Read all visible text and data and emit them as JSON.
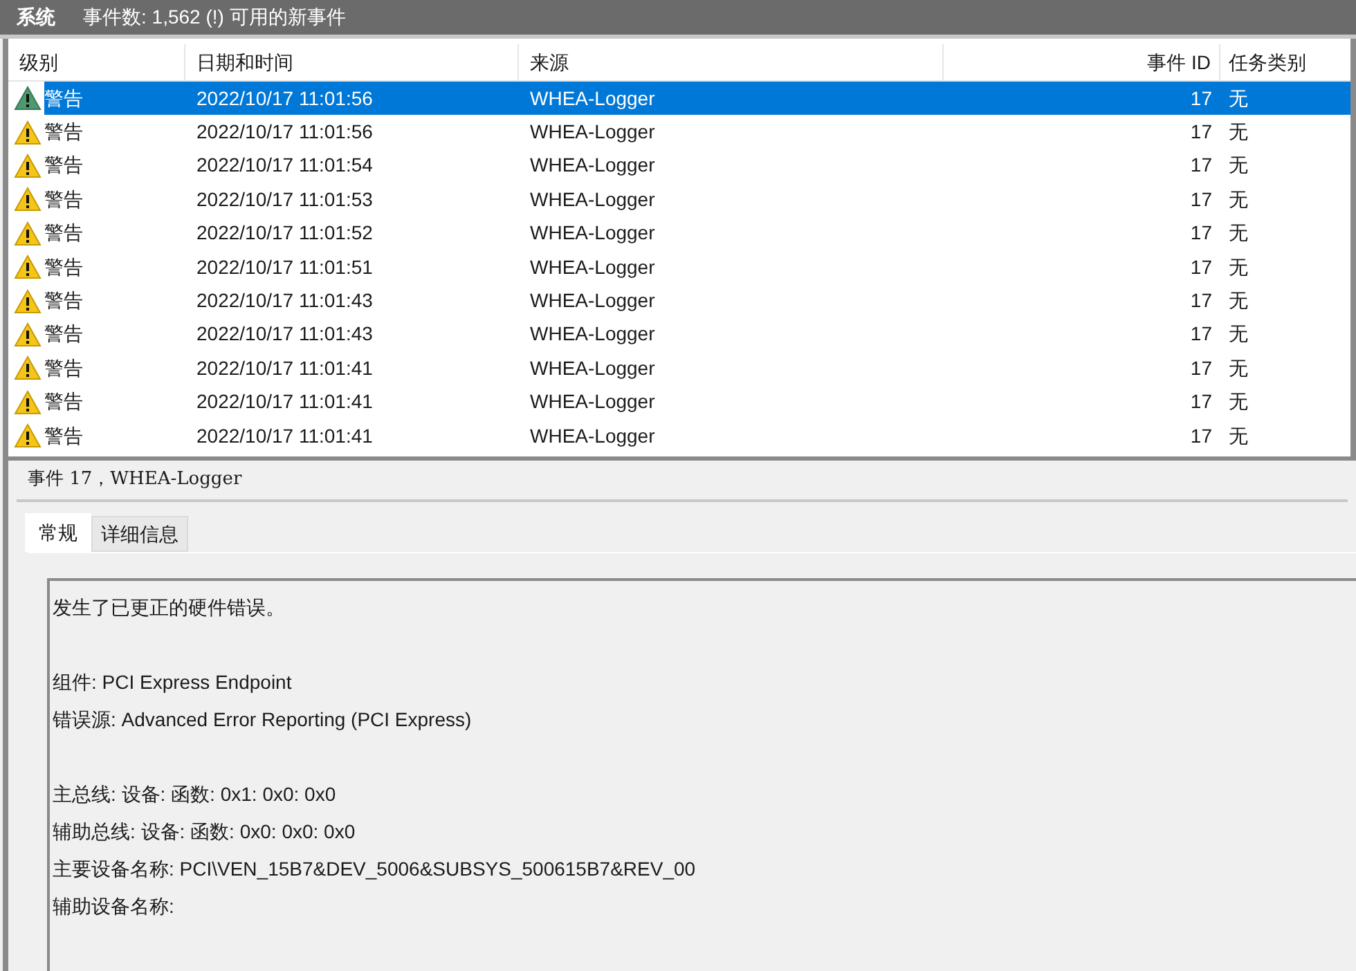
{
  "header": {
    "title": "系统",
    "summary": "事件数: 1,562 (!) 可用的新事件"
  },
  "table": {
    "columns": [
      "级别",
      "日期和时间",
      "来源",
      "事件 ID",
      "任务类别"
    ],
    "rows": [
      {
        "level": "警告",
        "datetime": "2022/10/17 11:01:56",
        "source": "WHEA-Logger",
        "event_id": "17",
        "task": "无",
        "selected": true
      },
      {
        "level": "警告",
        "datetime": "2022/10/17 11:01:56",
        "source": "WHEA-Logger",
        "event_id": "17",
        "task": "无",
        "selected": false
      },
      {
        "level": "警告",
        "datetime": "2022/10/17 11:01:54",
        "source": "WHEA-Logger",
        "event_id": "17",
        "task": "无",
        "selected": false
      },
      {
        "level": "警告",
        "datetime": "2022/10/17 11:01:53",
        "source": "WHEA-Logger",
        "event_id": "17",
        "task": "无",
        "selected": false
      },
      {
        "level": "警告",
        "datetime": "2022/10/17 11:01:52",
        "source": "WHEA-Logger",
        "event_id": "17",
        "task": "无",
        "selected": false
      },
      {
        "level": "警告",
        "datetime": "2022/10/17 11:01:51",
        "source": "WHEA-Logger",
        "event_id": "17",
        "task": "无",
        "selected": false
      },
      {
        "level": "警告",
        "datetime": "2022/10/17 11:01:43",
        "source": "WHEA-Logger",
        "event_id": "17",
        "task": "无",
        "selected": false
      },
      {
        "level": "警告",
        "datetime": "2022/10/17 11:01:43",
        "source": "WHEA-Logger",
        "event_id": "17",
        "task": "无",
        "selected": false
      },
      {
        "level": "警告",
        "datetime": "2022/10/17 11:01:41",
        "source": "WHEA-Logger",
        "event_id": "17",
        "task": "无",
        "selected": false
      },
      {
        "level": "警告",
        "datetime": "2022/10/17 11:01:41",
        "source": "WHEA-Logger",
        "event_id": "17",
        "task": "无",
        "selected": false
      },
      {
        "level": "警告",
        "datetime": "2022/10/17 11:01:41",
        "source": "WHEA-Logger",
        "event_id": "17",
        "task": "无",
        "selected": false
      }
    ]
  },
  "details": {
    "title": "事件 17，WHEA-Logger",
    "tabs": [
      {
        "label": "常规",
        "selected": true
      },
      {
        "label": "详细信息",
        "selected": false
      }
    ],
    "paragraphs": [
      [
        "发生了已更正的硬件错误。"
      ],
      [
        "组件: PCI Express Endpoint",
        "错误源: Advanced Error Reporting (PCI Express)"
      ],
      [
        "主总线: 设备: 函数: 0x1: 0x0: 0x0",
        "辅助总线: 设备: 函数: 0x0: 0x0: 0x0",
        "主要设备名称: PCI\\VEN_15B7&DEV_5006&SUBSYS_500615B7&REV_00",
        "辅助设备名称:"
      ]
    ]
  }
}
